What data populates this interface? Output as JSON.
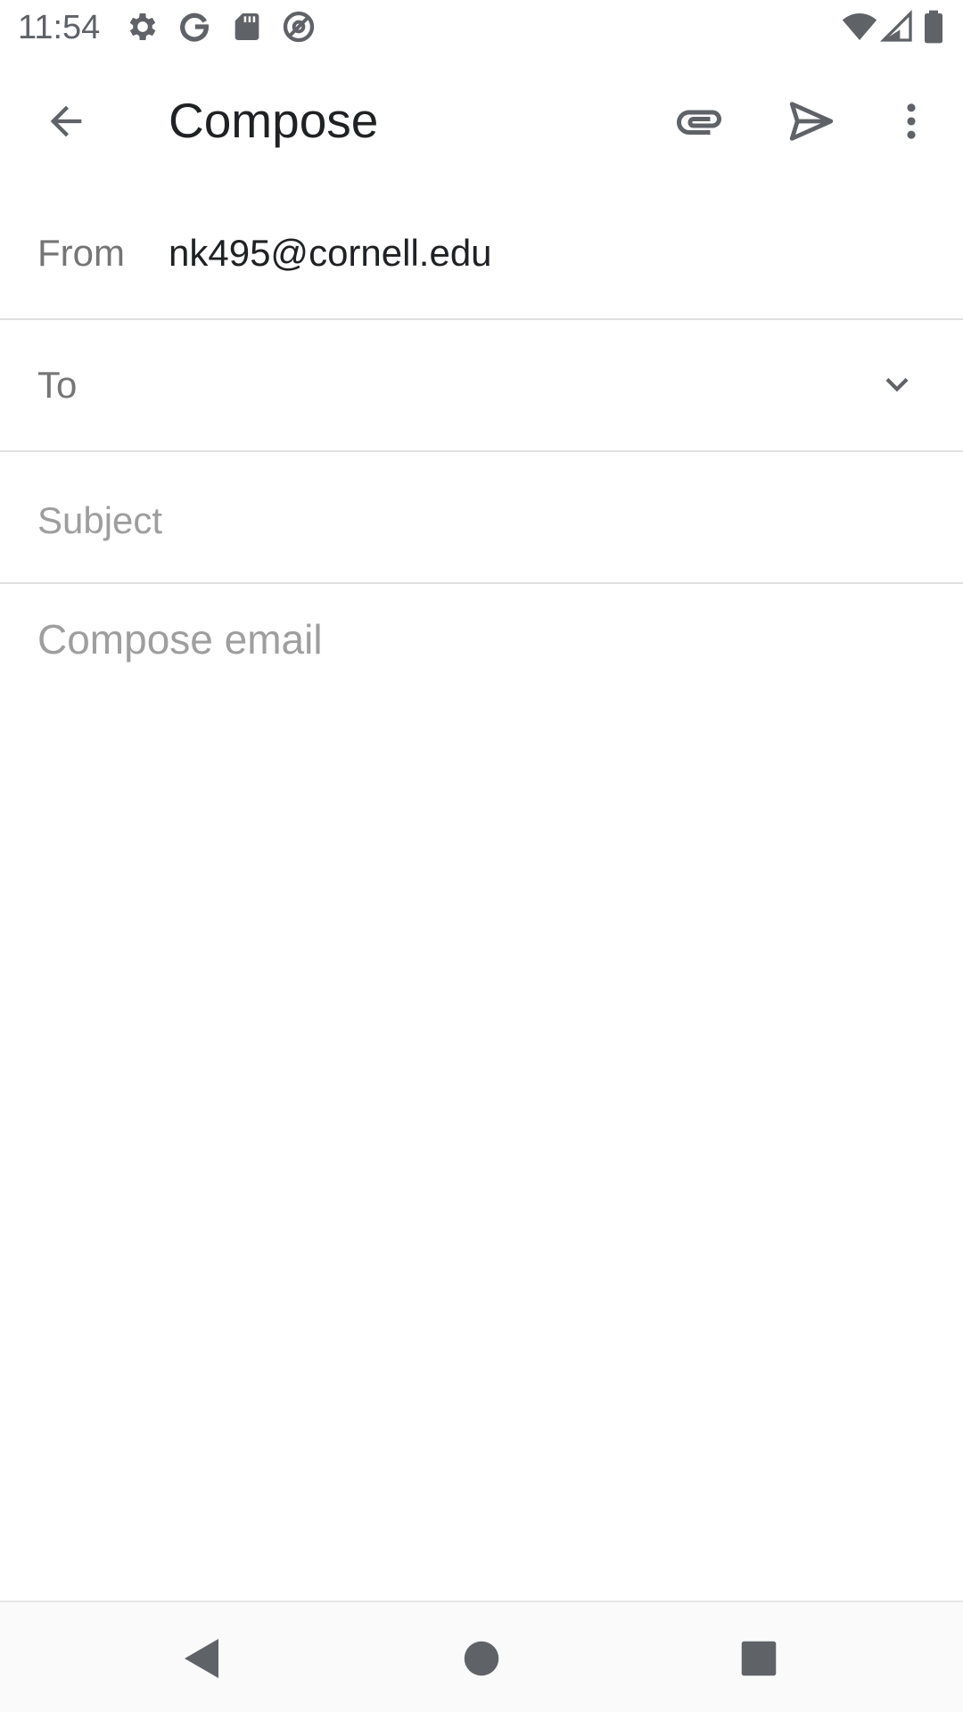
{
  "status_bar": {
    "time": "11:54",
    "left_icons": [
      "settings-icon",
      "google-icon",
      "sd-card-icon",
      "at-sign-icon"
    ],
    "right_icons": [
      "wifi-icon",
      "cell-signal-icon",
      "battery-icon"
    ]
  },
  "app_bar": {
    "title": "Compose",
    "actions": [
      "attach-icon",
      "send-icon",
      "more-vert-icon"
    ]
  },
  "compose": {
    "from_label": "From",
    "from_value": "nk495@cornell.edu",
    "to_label": "To",
    "to_value": "",
    "subject_placeholder": "Subject",
    "subject_value": "",
    "body_placeholder": "Compose email",
    "body_value": ""
  },
  "nav_bar": {
    "buttons": [
      "back-triangle-icon",
      "home-circle-icon",
      "recents-square-icon"
    ]
  },
  "colors": {
    "icon": "#5f6368",
    "text_primary": "#202124",
    "text_secondary": "#757575",
    "placeholder": "#9e9e9e",
    "divider": "#e0e0e0"
  }
}
